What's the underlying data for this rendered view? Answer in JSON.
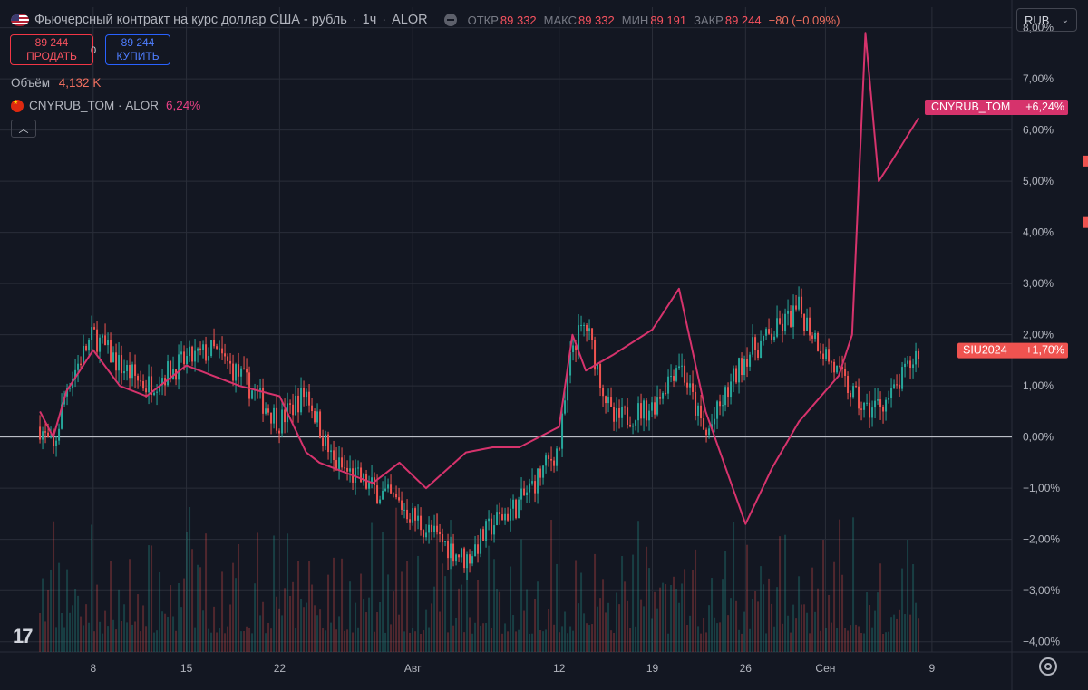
{
  "header": {
    "title": "Фьючерсный контракт на курс доллар США - рубль",
    "interval": "1ч",
    "exchange": "ALOR",
    "ohlc": [
      {
        "label": "ОТКР",
        "value": "89 332"
      },
      {
        "label": "МАКС",
        "value": "89 332"
      },
      {
        "label": "МИН",
        "value": "89 191"
      },
      {
        "label": "ЗАКР",
        "value": "89 244"
      }
    ],
    "change": "−80 (−0,09%)"
  },
  "trade": {
    "sell_price": "89 244",
    "sell_label": "ПРОДАТЬ",
    "spread": "0",
    "buy_price": "89 244",
    "buy_label": "КУПИТЬ"
  },
  "volume": {
    "label": "Объём",
    "value": "4,132 K"
  },
  "compare": {
    "symbol": "CNYRUB_TOM",
    "exchange": "ALOR",
    "value": "6,24%"
  },
  "currency": {
    "selected": "RUB"
  },
  "icons": [
    "us-flag-icon",
    "eye-off-icon",
    "cn-flag-icon",
    "chevron-up-icon",
    "chevron-down-icon",
    "tradingview-logo-icon",
    "settings-icon"
  ],
  "colors": {
    "background": "#131722",
    "grid": "#2a2e39",
    "up": "#26a69a",
    "down": "#ef5350",
    "compare_line": "#d6336c",
    "zero_line": "#d1d4dc",
    "badge_main": "#ef5350"
  },
  "chart_data": {
    "type": "line",
    "y_unit": "%",
    "ylim": [
      -4.2,
      8.4
    ],
    "y_ticks": [
      "8,00%",
      "7,00%",
      "6,00%",
      "5,00%",
      "4,00%",
      "3,00%",
      "2,00%",
      "1,00%",
      "0,00%",
      "−1,00%",
      "−2,00%",
      "−3,00%",
      "−4,00%"
    ],
    "x_ticks": [
      "8",
      "15",
      "22",
      "Авг",
      "12",
      "19",
      "26",
      "Сен",
      "9"
    ],
    "grid": true,
    "series": [
      {
        "name": "SIU2024",
        "style": "candles",
        "last_label": "+1,70%",
        "x": [
          "2024-07-04",
          "2024-07-05",
          "2024-07-06",
          "2024-07-08",
          "2024-07-10",
          "2024-07-12",
          "2024-07-15",
          "2024-07-17",
          "2024-07-19",
          "2024-07-22",
          "2024-07-24",
          "2024-07-25",
          "2024-07-26",
          "2024-07-29",
          "2024-07-31",
          "2024-08-02",
          "2024-08-05",
          "2024-08-07",
          "2024-08-09",
          "2024-08-12",
          "2024-08-13",
          "2024-08-14",
          "2024-08-16",
          "2024-08-19",
          "2024-08-21",
          "2024-08-23",
          "2024-08-26",
          "2024-08-28",
          "2024-08-30",
          "2024-09-02",
          "2024-09-04",
          "2024-09-06",
          "2024-09-08"
        ],
        "values": [
          0.2,
          -0.3,
          1.0,
          2.0,
          1.4,
          1.0,
          1.5,
          1.7,
          1.2,
          0.3,
          0.9,
          0.2,
          -0.5,
          -1.0,
          -1.3,
          -1.8,
          -2.4,
          -1.7,
          -1.3,
          -0.2,
          1.8,
          2.2,
          0.3,
          0.6,
          1.5,
          0.0,
          1.6,
          2.0,
          2.5,
          1.2,
          0.5,
          0.8,
          1.7
        ]
      },
      {
        "name": "CNYRUB_TOM",
        "style": "line",
        "last_label": "+6,24%",
        "x": [
          "2024-07-04",
          "2024-07-05",
          "2024-07-06",
          "2024-07-08",
          "2024-07-10",
          "2024-07-12",
          "2024-07-15",
          "2024-07-17",
          "2024-07-19",
          "2024-07-22",
          "2024-07-24",
          "2024-07-25",
          "2024-07-26",
          "2024-07-29",
          "2024-07-31",
          "2024-08-02",
          "2024-08-05",
          "2024-08-07",
          "2024-08-09",
          "2024-08-12",
          "2024-08-13",
          "2024-08-14",
          "2024-08-16",
          "2024-08-19",
          "2024-08-21",
          "2024-08-23",
          "2024-08-26",
          "2024-08-28",
          "2024-08-30",
          "2024-09-02",
          "2024-09-03",
          "2024-09-04",
          "2024-09-05",
          "2024-09-06",
          "2024-09-08"
        ],
        "values": [
          0.5,
          0.0,
          0.9,
          1.7,
          1.0,
          0.8,
          1.4,
          1.2,
          1.0,
          0.8,
          -0.3,
          -0.5,
          -0.6,
          -0.9,
          -0.5,
          -1.0,
          -0.3,
          -0.2,
          -0.2,
          0.2,
          2.0,
          1.3,
          1.6,
          2.1,
          2.9,
          0.5,
          -1.7,
          -0.6,
          0.3,
          1.2,
          2.0,
          7.9,
          5.0,
          5.4,
          6.24
        ]
      }
    ],
    "volume_bars": true
  }
}
